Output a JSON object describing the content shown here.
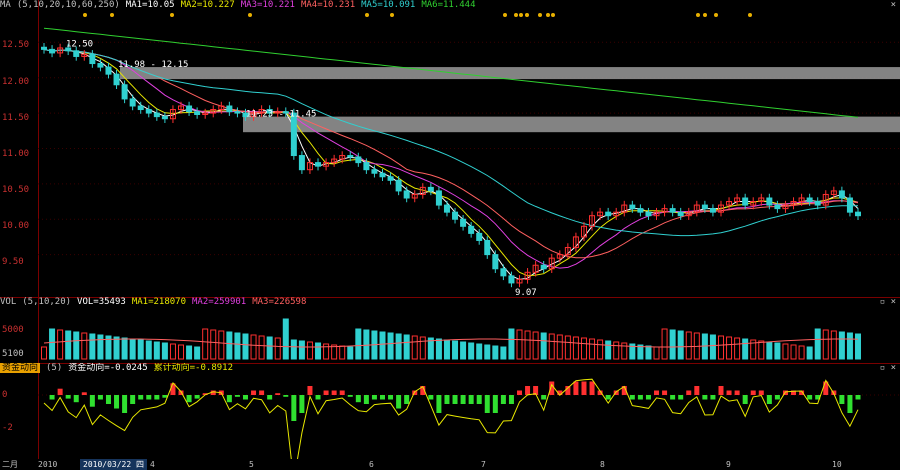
{
  "main_header": {
    "indicator": "MA",
    "params": "(5,10,20,10,60,250)",
    "ma1": "MA1=10.05",
    "ma2": "MA2=10.227",
    "ma3": "MA3=10.221",
    "ma4": "MA4=10.231",
    "ma5": "MA5=10.091",
    "ma6": "MA6=11.444",
    "colors": {
      "ma1": "#ffffff",
      "ma2": "#e8e800",
      "ma3": "#e040e0",
      "ma4": "#ff6060",
      "ma5": "#30d0d0",
      "ma6": "#30d030"
    }
  },
  "main_ticks": [
    "12.50",
    "12.00",
    "11.50",
    "11.00",
    "10.50",
    "10.00",
    "9.50"
  ],
  "annotations": {
    "high": "12.50",
    "zone1": "11.98 - 12.15",
    "zone2": "11.23 - 11.45",
    "low": "9.07"
  },
  "vol_header": {
    "indicator": "VOL",
    "params": "(5,10,20)",
    "vol": "VOL=35493",
    "ma1": "MA1=218070",
    "ma2": "MA2=259901",
    "ma3": "MA3=226598"
  },
  "vol_ticks": [
    "5000",
    "5100"
  ],
  "ind_header": {
    "name": "资金动向",
    "param": "(5)",
    "v1": "资金动向=-0.0245",
    "v2": "累计动向=-0.8912"
  },
  "ind_ticks": [
    "0",
    "-2"
  ],
  "bottom": {
    "left_label": "二月",
    "year": "2010",
    "date": "2010/03/22 四",
    "months": [
      "4",
      "5",
      "6",
      "7",
      "8",
      "9",
      "10"
    ]
  },
  "chart_data": {
    "type": "candlestick",
    "title": "",
    "ylim": [
      9.0,
      12.9
    ],
    "annotated_high": 12.5,
    "annotated_low": 9.07,
    "resistance_zones": [
      [
        11.98,
        12.15
      ],
      [
        11.23,
        11.45
      ]
    ],
    "close_series": [
      12.4,
      12.35,
      12.42,
      12.38,
      12.3,
      12.33,
      12.2,
      12.15,
      12.05,
      11.9,
      11.7,
      11.6,
      11.55,
      11.5,
      11.45,
      11.42,
      11.55,
      11.6,
      11.52,
      11.48,
      11.5,
      11.55,
      11.6,
      11.52,
      11.5,
      11.45,
      11.5,
      11.55,
      11.5,
      11.52,
      11.5,
      10.9,
      10.7,
      10.8,
      10.75,
      10.8,
      10.85,
      10.9,
      10.88,
      10.8,
      10.7,
      10.65,
      10.6,
      10.55,
      10.4,
      10.3,
      10.35,
      10.45,
      10.4,
      10.2,
      10.1,
      10.0,
      9.9,
      9.8,
      9.7,
      9.5,
      9.3,
      9.2,
      9.1,
      9.15,
      9.25,
      9.35,
      9.3,
      9.45,
      9.5,
      9.6,
      9.75,
      9.9,
      10.05,
      10.1,
      10.05,
      10.1,
      10.2,
      10.15,
      10.1,
      10.05,
      10.1,
      10.15,
      10.1,
      10.05,
      10.1,
      10.2,
      10.15,
      10.1,
      10.2,
      10.25,
      10.3,
      10.2,
      10.25,
      10.3,
      10.2,
      10.15,
      10.2,
      10.25,
      10.3,
      10.25,
      10.2,
      10.35,
      10.4,
      10.3,
      10.1,
      10.05
    ]
  }
}
